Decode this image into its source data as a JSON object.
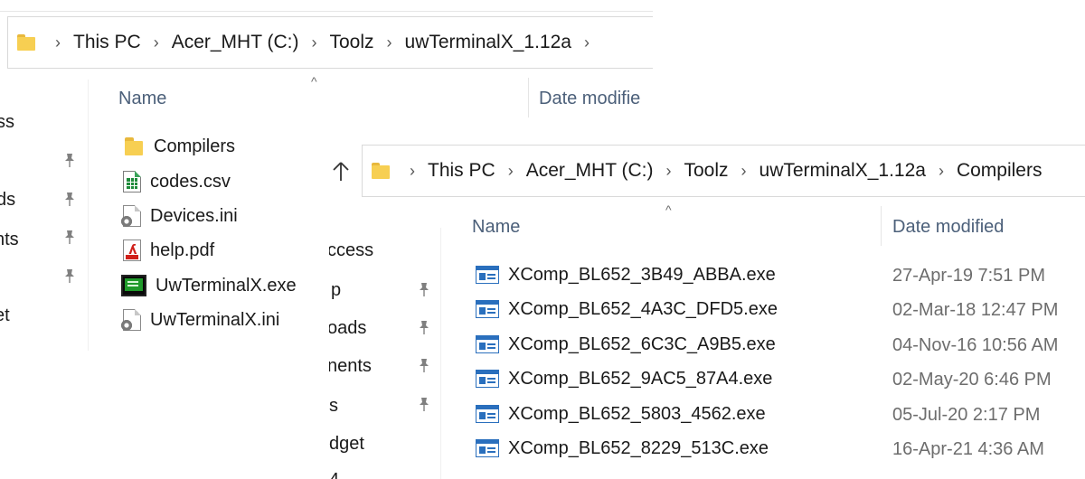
{
  "back_window": {
    "breadcrumb": [
      "This PC",
      "Acer_MHT (C:)",
      "Toolz",
      "uwTerminalX_1.12a"
    ],
    "columns": {
      "name": "Name",
      "date": "Date modifie"
    },
    "nav_items": [
      "ss",
      "ds",
      "nts",
      "et"
    ],
    "files": [
      {
        "name": "Compilers",
        "icon": "folder-icon"
      },
      {
        "name": "codes.csv",
        "icon": "csv-file-icon"
      },
      {
        "name": "Devices.ini",
        "icon": "ini-file-icon"
      },
      {
        "name": "help.pdf",
        "icon": "pdf-file-icon"
      },
      {
        "name": "UwTerminalX.exe",
        "icon": "terminal-exe-icon"
      },
      {
        "name": "UwTerminalX.ini",
        "icon": "ini-file-icon"
      }
    ]
  },
  "front_window": {
    "breadcrumb": [
      "This PC",
      "Acer_MHT (C:)",
      "Toolz",
      "uwTerminalX_1.12a",
      "Compilers"
    ],
    "columns": {
      "name": "Name",
      "date": "Date modified"
    },
    "nav_items": [
      "ccess",
      "p",
      "oads",
      "nents",
      "s",
      "dget",
      "4 ..."
    ],
    "files": [
      {
        "name": "XComp_BL652_3B49_ABBA.exe",
        "date": "27-Apr-19 7:51 PM"
      },
      {
        "name": "XComp_BL652_4A3C_DFD5.exe",
        "date": "02-Mar-18 12:47 PM"
      },
      {
        "name": "XComp_BL652_6C3C_A9B5.exe",
        "date": "04-Nov-16 10:56 AM"
      },
      {
        "name": "XComp_BL652_9AC5_87A4.exe",
        "date": "02-May-20 6:46 PM"
      },
      {
        "name": "XComp_BL652_5803_4562.exe",
        "date": "05-Jul-20 2:17 PM"
      },
      {
        "name": "XComp_BL652_8229_513C.exe",
        "date": "16-Apr-21 4:36 AM"
      }
    ]
  },
  "colors": {
    "header_text": "#4c607a",
    "date_text": "#6d6d6d",
    "folder": "#f7cf52",
    "exe_blue": "#2a6fbd"
  }
}
